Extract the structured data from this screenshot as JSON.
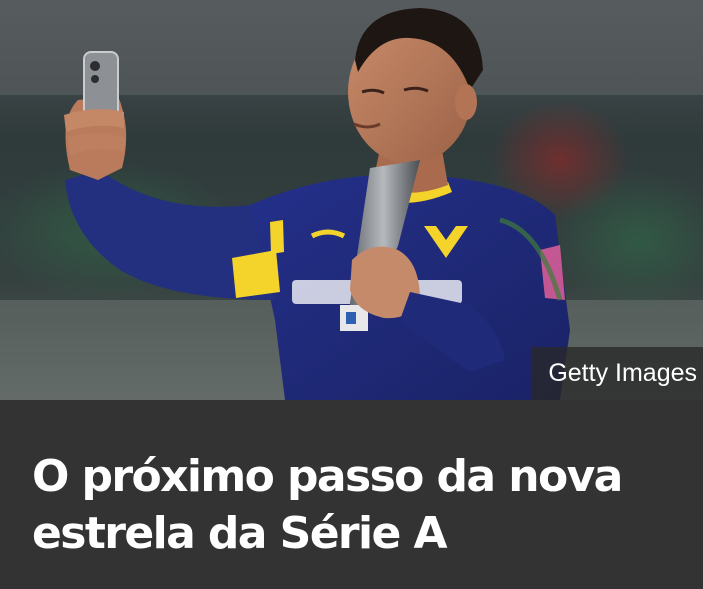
{
  "article_card": {
    "image": {
      "alt": "",
      "credit": "Getty Images"
    },
    "headline": {
      "line1": "O próximo passo da nova",
      "line2": "estrela da Série A"
    },
    "colors": {
      "card_background": "#333333",
      "headline_text": "#ffffff",
      "jersey": "#1f2a7a",
      "jersey_accent": "#f4d32a"
    }
  }
}
